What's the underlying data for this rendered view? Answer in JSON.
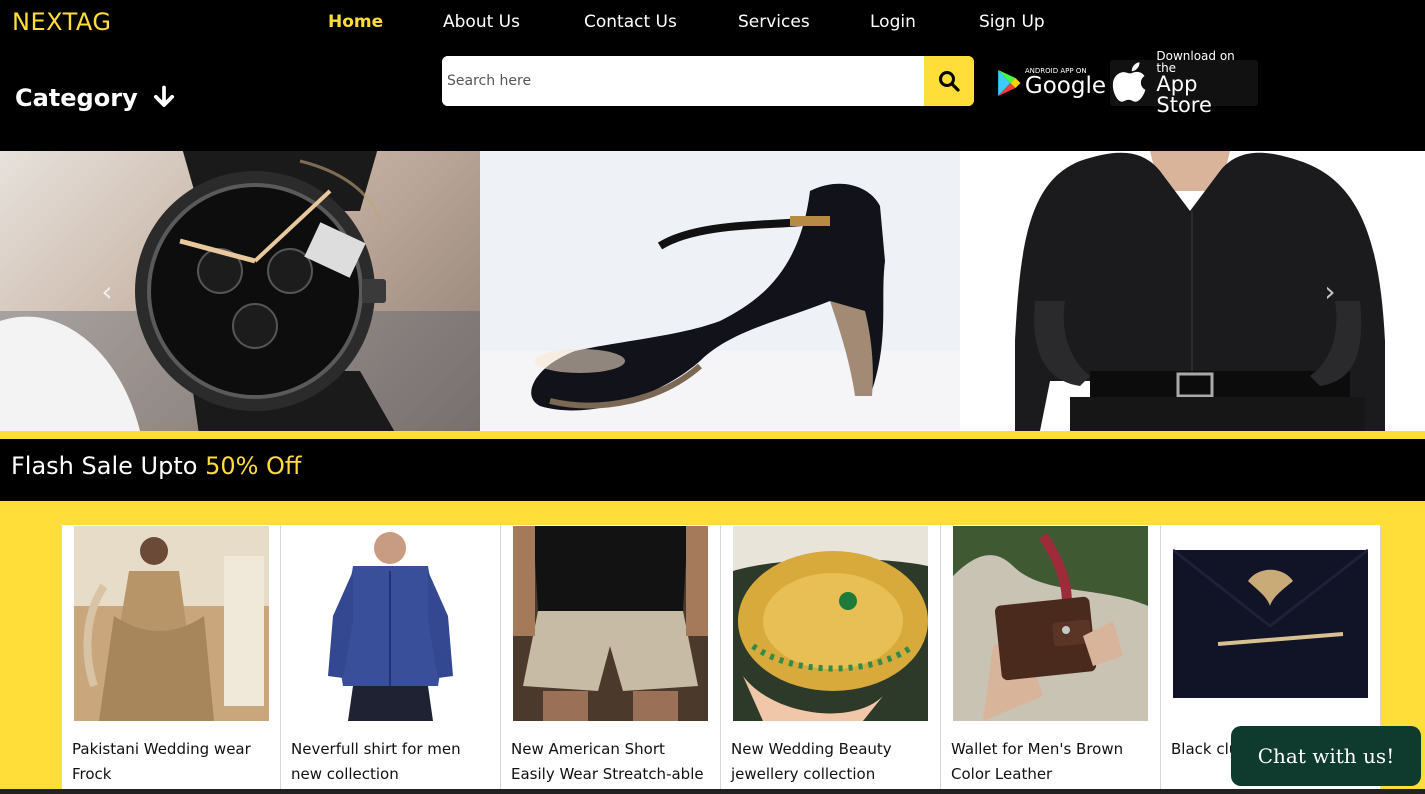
{
  "brand": "NEXTAG",
  "nav": {
    "items": [
      {
        "label": "Home",
        "active": true
      },
      {
        "label": "About Us",
        "active": false
      },
      {
        "label": "Contact Us",
        "active": false
      },
      {
        "label": "Services",
        "active": false
      },
      {
        "label": "Login",
        "active": false
      },
      {
        "label": "Sign Up",
        "active": false
      }
    ]
  },
  "category": {
    "label": "Category",
    "icon": "arrow-down-icon"
  },
  "search": {
    "placeholder": "Search here",
    "value": "",
    "icon": "search-icon"
  },
  "stores": {
    "google": {
      "small": "ANDROID APP ON",
      "big": "Google",
      "icon": "google-play-icon"
    },
    "apple": {
      "small": "Download on the",
      "big": "App Store",
      "icon": "apple-icon"
    }
  },
  "carousel": {
    "slides": [
      "watch",
      "heels",
      "black-shirt"
    ],
    "prev_icon": "chevron-left-icon",
    "next_icon": "chevron-right-icon"
  },
  "flash": {
    "prefix": "Flash Sale Upto ",
    "highlight": "50% Off"
  },
  "products": [
    {
      "name": "Pakistani Wedding wear Frock",
      "image": "bridal-dress"
    },
    {
      "name": "Neverfull shirt for men new collection",
      "image": "blue-shirt"
    },
    {
      "name": "New American Short Easily Wear Streatch-able",
      "image": "cargo-shorts"
    },
    {
      "name": "New Wedding Beauty jewellery collection",
      "image": "gold-jewellery"
    },
    {
      "name": "Wallet for Men's Brown Color Leather",
      "image": "brown-wallet"
    },
    {
      "name": "Black clutch collection",
      "image": "black-clutch"
    }
  ],
  "chat": {
    "label": "Chat with us!"
  },
  "colors": {
    "accent": "#ffde3a",
    "background": "#000000",
    "chat": "#0e3b2d"
  }
}
